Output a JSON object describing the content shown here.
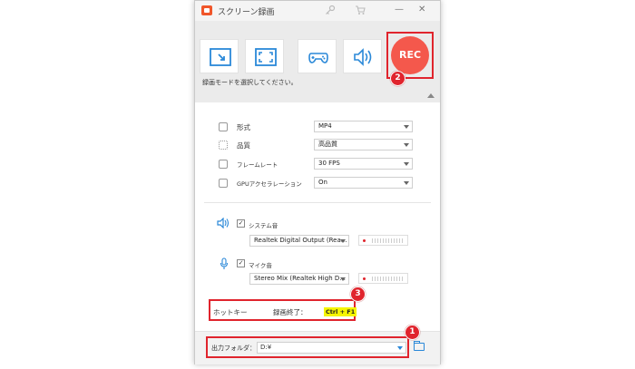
{
  "window": {
    "title": "スクリーン録画",
    "icons": [
      "key-icon",
      "cart-icon",
      "minimize-icon",
      "close-icon"
    ],
    "minimize_glyph": "—",
    "close_glyph": "✕"
  },
  "modes": {
    "buttons": [
      "region-capture-icon",
      "fullscreen-icon",
      "game-icon",
      "audio-only-icon"
    ],
    "rec_label": "REC",
    "hint": "録画モードを選択してください。"
  },
  "settings": {
    "format": {
      "label": "形式",
      "value": "MP4"
    },
    "quality": {
      "label": "品質",
      "value": "高品質"
    },
    "framerate": {
      "label": "フレームレート",
      "value": "30 FPS"
    },
    "gpu": {
      "label": "GPUアクセラレーション",
      "value": "On"
    }
  },
  "audio": {
    "system": {
      "label": "システム音",
      "checked": "✓",
      "device": "Realtek Digital Output (Rea..."
    },
    "mic": {
      "label": "マイク音",
      "checked": "✓",
      "device": "Stereo Mix (Realtek High D..."
    }
  },
  "hotkey": {
    "label": "ホットキー",
    "action": "録画終了：",
    "value": "Ctrl + F1"
  },
  "output": {
    "label": "出力フォルダ：",
    "path": "D:¥"
  },
  "badges": {
    "one": "1",
    "two": "2",
    "three": "3"
  },
  "colors": {
    "accent_red": "#e0242d",
    "rec_red": "#f4584c",
    "icon_blue": "#2a88d8",
    "highlight": "#f5f500"
  }
}
